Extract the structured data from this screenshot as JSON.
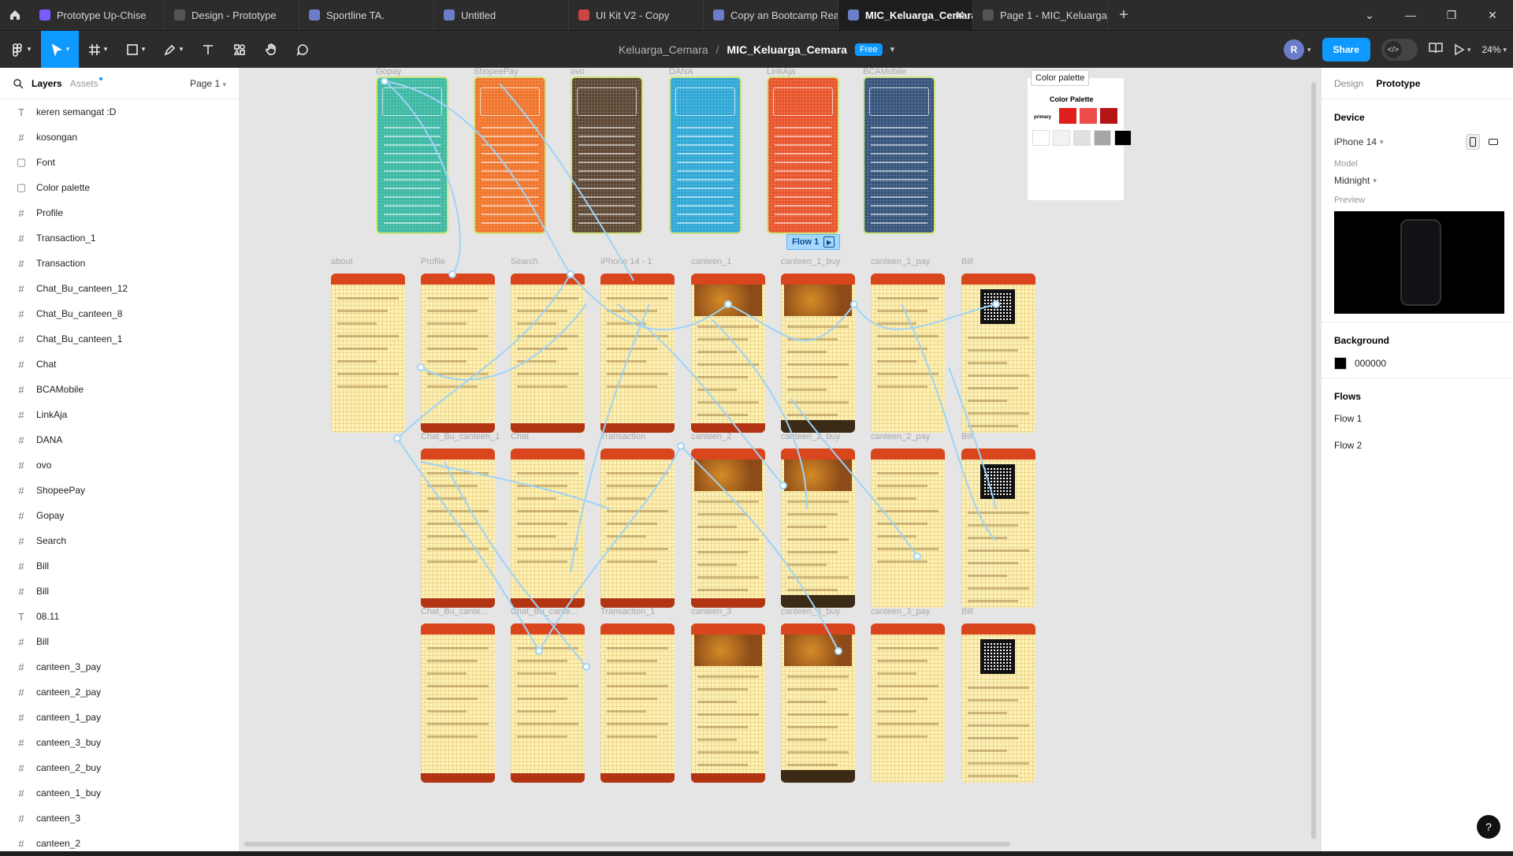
{
  "tabs": [
    {
      "label": "Prototype Up-Chise",
      "icon": "figma-prototype-icon",
      "color": "#7c5cff"
    },
    {
      "label": "Design - Prototype",
      "icon": "play-icon",
      "color": "#555555"
    },
    {
      "label": "Sportline TA.",
      "icon": "design-file-icon",
      "color": "#6b7dc8"
    },
    {
      "label": "Untitled",
      "icon": "design-file-icon",
      "color": "#6b7dc8"
    },
    {
      "label": "UI Kit V2 - Copy",
      "icon": "community-file-icon",
      "color": "#c44"
    },
    {
      "label": "Copy an Bootcamp React",
      "icon": "design-file-icon",
      "color": "#6b7dc8"
    },
    {
      "label": "MIC_Keluarga_Cemara",
      "icon": "design-file-icon",
      "color": "#6b7dc8",
      "active": true
    },
    {
      "label": "Page 1 - MIC_Keluarga_Cemara",
      "icon": "play-icon",
      "color": "#555555"
    }
  ],
  "toolbar": {
    "project": "Keluarga_Cemara",
    "separator": "/",
    "file": "MIC_Keluarga_Cemara",
    "plan_badge": "Free",
    "avatar_initial": "R",
    "share_label": "Share",
    "zoom": "24%"
  },
  "left_panel": {
    "layers_tab": "Layers",
    "assets_tab": "Assets",
    "page_selector": "Page 1",
    "layers": [
      {
        "type": "text",
        "name": "keren semangat :D"
      },
      {
        "type": "frame",
        "name": "kosongan"
      },
      {
        "type": "group",
        "name": "Font"
      },
      {
        "type": "group",
        "name": "Color palette"
      },
      {
        "type": "frame",
        "name": "Profile"
      },
      {
        "type": "frame",
        "name": "Transaction_1"
      },
      {
        "type": "frame",
        "name": "Transaction"
      },
      {
        "type": "frame",
        "name": "Chat_Bu_canteen_12"
      },
      {
        "type": "frame",
        "name": "Chat_Bu_canteen_8"
      },
      {
        "type": "frame",
        "name": "Chat_Bu_canteen_1"
      },
      {
        "type": "frame",
        "name": "Chat"
      },
      {
        "type": "frame",
        "name": "BCAMobile"
      },
      {
        "type": "frame",
        "name": "LinkAja"
      },
      {
        "type": "frame",
        "name": "DANA"
      },
      {
        "type": "frame",
        "name": "ovo"
      },
      {
        "type": "frame",
        "name": "ShopeePay"
      },
      {
        "type": "frame",
        "name": "Gopay"
      },
      {
        "type": "frame",
        "name": "Search"
      },
      {
        "type": "frame",
        "name": "Bill"
      },
      {
        "type": "frame",
        "name": "Bill"
      },
      {
        "type": "text",
        "name": "08.11"
      },
      {
        "type": "frame",
        "name": "Bill"
      },
      {
        "type": "frame",
        "name": "canteen_3_pay"
      },
      {
        "type": "frame",
        "name": "canteen_2_pay"
      },
      {
        "type": "frame",
        "name": "canteen_1_pay"
      },
      {
        "type": "frame",
        "name": "canteen_3_buy"
      },
      {
        "type": "frame",
        "name": "canteen_2_buy"
      },
      {
        "type": "frame",
        "name": "canteen_1_buy"
      },
      {
        "type": "frame",
        "name": "canteen_3"
      },
      {
        "type": "frame",
        "name": "canteen_2"
      }
    ]
  },
  "canvas": {
    "payment_frames": [
      {
        "label": "Gopay",
        "color": "#3bb8a3"
      },
      {
        "label": "ShopeePay",
        "color": "#f0742a"
      },
      {
        "label": "ovo",
        "color": "#5b4532"
      },
      {
        "label": "DANA",
        "color": "#2ea7d6"
      },
      {
        "label": "LinkAja",
        "color": "#e8532a"
      },
      {
        "label": "BCAMobile",
        "color": "#35527a"
      }
    ],
    "row1_labels": [
      "about",
      "Profile",
      "Search",
      "iPhone 14 - 1",
      "canteen_1",
      "canteen_1_buy",
      "canteen_1_pay",
      "Bill"
    ],
    "row2_labels": [
      "Chat_Bu_canteen_1",
      "Chat",
      "Transaction",
      "canteen_2",
      "canteen_2_buy",
      "canteen_2_pay",
      "Bill"
    ],
    "row3_labels": [
      "Chat_Bu_cante...",
      "Chat_Bu_cante...",
      "Transaction_1",
      "canteen_3",
      "canteen_3_buy",
      "canteen_3_pay",
      "Bill"
    ],
    "flow_tag": "Flow 1",
    "palette": {
      "frame_title": "Color palette",
      "heading": "Color Palette",
      "primary_label": "primary",
      "primary_colors": [
        "#e01e1e",
        "#ee4b4b",
        "#b51414"
      ],
      "neutral_colors": [
        "#ffffff",
        "#f2f2f2",
        "#e0e0e0",
        "#a6a6a6",
        "#000000"
      ]
    }
  },
  "right_panel": {
    "tab_design": "Design",
    "tab_prototype": "Prototype",
    "device_heading": "Device",
    "device_value": "iPhone 14",
    "model_label": "Model",
    "model_value": "Midnight",
    "preview_label": "Preview",
    "background_heading": "Background",
    "background_hex": "000000",
    "background_color": "#000000",
    "flows_heading": "Flows",
    "flows": [
      "Flow 1",
      "Flow 2"
    ],
    "help": "?"
  },
  "colors": {
    "accent": "#0d99ff",
    "wire": "#9fd3f7",
    "frame_header": "#d9461e",
    "frame_bg": "#fdf0b8"
  }
}
